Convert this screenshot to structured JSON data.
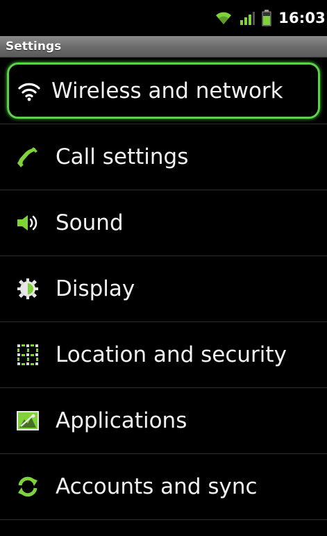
{
  "status_bar": {
    "time": "16:03",
    "icons": [
      "wifi-icon",
      "signal-icon",
      "battery-icon"
    ],
    "accent_color": "#7fd23a"
  },
  "header": {
    "title": "Settings"
  },
  "settings_list": {
    "items": [
      {
        "label": "Wireless and network",
        "icon": "wifi-icon",
        "focused": true
      },
      {
        "label": "Call settings",
        "icon": "phone-icon"
      },
      {
        "label": "Sound",
        "icon": "speaker-icon"
      },
      {
        "label": "Display",
        "icon": "display-brightness-icon"
      },
      {
        "label": "Location and security",
        "icon": "location-grid-icon"
      },
      {
        "label": "Applications",
        "icon": "applications-icon"
      },
      {
        "label": "Accounts and sync",
        "icon": "sync-icon"
      }
    ],
    "focus_color": "#5bd24a"
  }
}
